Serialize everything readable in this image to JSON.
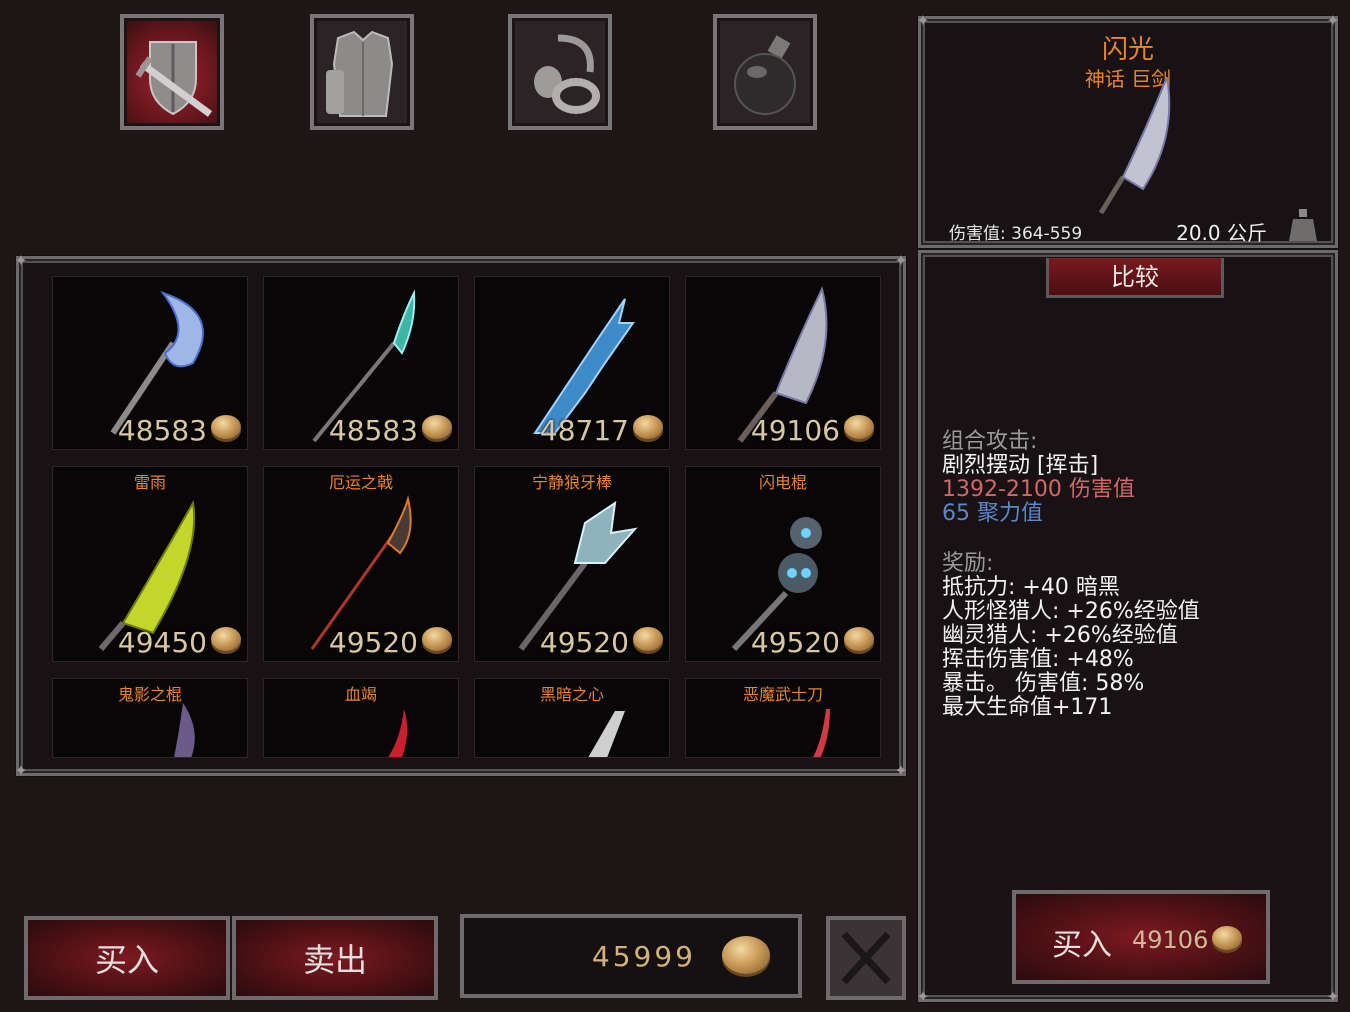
{
  "tabs": [
    {
      "name": "weapons-shield",
      "icon": "sword-shield-icon",
      "active": true
    },
    {
      "name": "armor",
      "icon": "armor-icon",
      "active": false
    },
    {
      "name": "jewelry",
      "icon": "amulet-ring-icon",
      "active": false
    },
    {
      "name": "potions",
      "icon": "potion-icon",
      "active": false
    }
  ],
  "grid": {
    "row1": [
      {
        "name": "",
        "price": "48583"
      },
      {
        "name": "",
        "price": "48583"
      },
      {
        "name": "",
        "price": "48717"
      },
      {
        "name": "",
        "price": "49106"
      }
    ],
    "row2": [
      {
        "name": "雷雨",
        "price": "49450"
      },
      {
        "name": "厄运之戟",
        "price": "49520"
      },
      {
        "name": "宁静狼牙棒",
        "price": "49520"
      },
      {
        "name": "闪电棍",
        "price": "49520"
      }
    ],
    "row3": [
      {
        "name": "鬼影之棍"
      },
      {
        "name": "血竭"
      },
      {
        "name": "黑暗之心"
      },
      {
        "name": "恶魔武士刀"
      }
    ]
  },
  "detail": {
    "name": "闪光",
    "subtitle": "神话 巨剑",
    "damage": "伤害值: 364-559",
    "weight": "20.0 公斤"
  },
  "compare": {
    "tab_label": "比较",
    "combo_title": "组合攻击:",
    "combo_move": "剧烈摆动 [挥击]",
    "combo_damage": "1392-2100 伤害值",
    "combo_focus": "65 聚力值",
    "bonus_title": "奖励:",
    "bonuses": [
      "抵抗力:  +40 暗黑",
      "人形怪猎人:  +26%经验值",
      "幽灵猎人:  +26%经验值",
      "挥击伤害值:  +48%",
      "暴击。 伤害值:  58%",
      "最大生命值+171"
    ]
  },
  "buttons": {
    "buy": "买入",
    "sell": "卖出",
    "gold": "45999",
    "buy_item_label": "买入",
    "buy_item_price": "49106"
  },
  "colors": {
    "background": "#1e1517",
    "item_name": "#e8852a",
    "damage_red": "#d26767",
    "focus_blue": "#5b87c9",
    "button_red": "#7c1a21"
  }
}
